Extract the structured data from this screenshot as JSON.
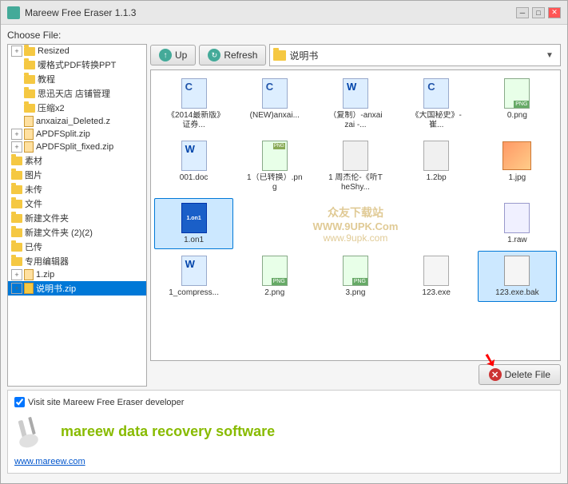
{
  "window": {
    "title": "Mareew Free Eraser 1.1.3",
    "icon": "eraser-icon"
  },
  "toolbar": {
    "up_label": "Up",
    "refresh_label": "Refresh",
    "path_text": "说明书",
    "delete_label": "Delete File"
  },
  "choose_file_label": "Choose File:",
  "tree": {
    "items": [
      {
        "label": "Resized",
        "type": "folder",
        "level": 0,
        "expanded": false
      },
      {
        "label": "嗳格式PDF转换PPT",
        "type": "folder",
        "level": 1,
        "expanded": false
      },
      {
        "label": "教程",
        "type": "folder",
        "level": 1,
        "expanded": false
      },
      {
        "label": "思迅天店 店铺管理",
        "type": "folder",
        "level": 1,
        "expanded": false
      },
      {
        "label": "压缩x2",
        "type": "folder",
        "level": 1,
        "expanded": false
      },
      {
        "label": "anxaizai_Deleted.z",
        "type": "file",
        "level": 1,
        "expanded": false
      },
      {
        "label": "APDFSplit.zip",
        "type": "zip",
        "level": 0,
        "expanded": false
      },
      {
        "label": "APDFSplit_fixed.zip",
        "type": "zip",
        "level": 0,
        "expanded": false
      },
      {
        "label": "素材",
        "type": "folder",
        "level": 0,
        "expanded": false
      },
      {
        "label": "图片",
        "type": "folder",
        "level": 0,
        "expanded": false
      },
      {
        "label": "未传",
        "type": "folder",
        "level": 0,
        "expanded": false
      },
      {
        "label": "文件",
        "type": "folder",
        "level": 0,
        "expanded": false
      },
      {
        "label": "新建文件夹",
        "type": "folder",
        "level": 0,
        "expanded": false
      },
      {
        "label": "新建文件夹 (2)(2)",
        "type": "folder",
        "level": 0,
        "expanded": false
      },
      {
        "label": "已传",
        "type": "folder",
        "level": 0,
        "expanded": false
      },
      {
        "label": "专用编辑器",
        "type": "folder",
        "level": 0,
        "expanded": false
      },
      {
        "label": "1.zip",
        "type": "zip",
        "level": 0,
        "expanded": false
      },
      {
        "label": "说明书.zip",
        "type": "zip",
        "level": 0,
        "expanded": false
      }
    ]
  },
  "files": [
    {
      "name": "《2014最新版》证券...",
      "type": "doc",
      "icon": "doc"
    },
    {
      "name": "(NEW)anxai... ",
      "type": "doc",
      "icon": "doc"
    },
    {
      "name": "（复制）-anxaizai -...",
      "type": "doc",
      "icon": "doc"
    },
    {
      "name": "《大国秘史》- 崔...",
      "type": "doc",
      "icon": "doc"
    },
    {
      "name": "0.png",
      "type": "png",
      "icon": "png"
    },
    {
      "name": "001.doc",
      "type": "doc",
      "icon": "doc-w"
    },
    {
      "name": "1（已转换）.png",
      "type": "png",
      "icon": "png"
    },
    {
      "name": "1 周杰伦-《听TheShy...",
      "type": "generic",
      "icon": "generic"
    },
    {
      "name": "1.2bp",
      "type": "generic",
      "icon": "generic"
    },
    {
      "name": "1.jpg",
      "type": "jpg",
      "icon": "jpg"
    },
    {
      "name": "1.on1",
      "type": "blue-dark",
      "icon": "blue-dark"
    },
    {
      "name": "",
      "type": "watermark-area",
      "icon": "none"
    },
    {
      "name": "",
      "type": "watermark-area2",
      "icon": "none"
    },
    {
      "name": "1.raw",
      "type": "raw",
      "icon": "raw"
    },
    {
      "name": "",
      "type": "empty",
      "icon": "none"
    },
    {
      "name": "1_compress...",
      "type": "doc-w",
      "icon": "doc-w"
    },
    {
      "name": "2.png",
      "type": "png",
      "icon": "png"
    },
    {
      "name": "3.png",
      "type": "png",
      "icon": "png"
    },
    {
      "name": "123.exe",
      "type": "exe",
      "icon": "exe"
    },
    {
      "name": "123.exe.bak",
      "type": "bak",
      "icon": "bak",
      "selected": true
    }
  ],
  "bottom": {
    "checkbox_label": "Visit site Mareew Free Eraser developer",
    "checkbox_checked": true,
    "ad_text": "mareew",
    "ad_brand": "data recovery software",
    "ad_link": "www.mareew.com"
  },
  "watermark": {
    "line1": "WWW.9UPK.Com",
    "line2": "www.9upk.com",
    "site": "众友下载站"
  }
}
